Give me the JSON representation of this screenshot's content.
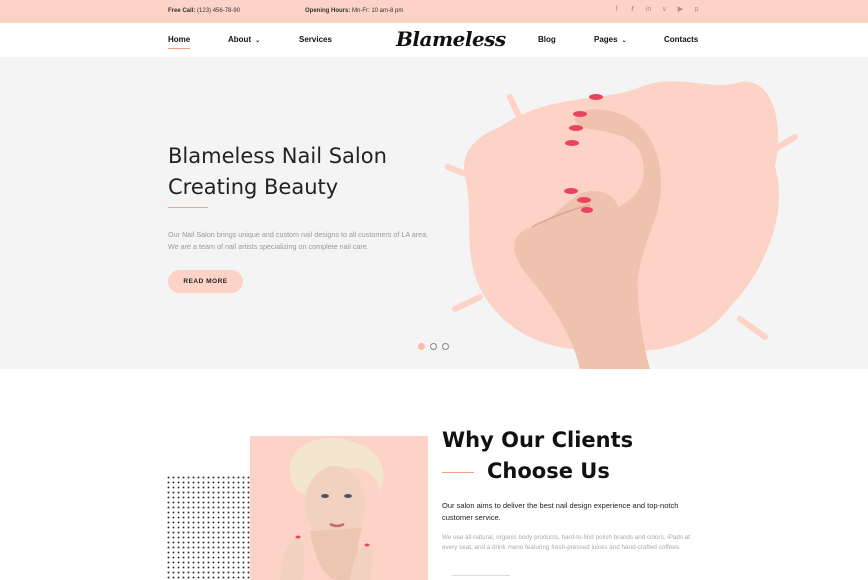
{
  "topbar": {
    "phone_label": "Free Call:",
    "phone_value": "(123) 456-78-90",
    "hours_label": "Opening Hours:",
    "hours_value": "Mn-Fr: 10 am-8 pm",
    "social": [
      "f",
      "t",
      "in",
      "v",
      "yt",
      "p"
    ]
  },
  "nav": {
    "home": "Home",
    "about": "About",
    "services": "Services",
    "logo": "Blameless",
    "blog": "Blog",
    "pages": "Pages",
    "contacts": "Contacts"
  },
  "hero": {
    "title_line1": "Blameless Nail Salon",
    "title_line2": "Creating Beauty",
    "description": "Our Nail Salon brings unique and custom nail designs to all customers of LA area. We are a team of nail artists specializing on complete nail care.",
    "button": "READ MORE",
    "slides": 3,
    "active_slide": 1
  },
  "about": {
    "title_line1": "Why Our Clients",
    "title_line2": "Choose Us",
    "lead": "Our salon aims to deliver the best nail design experience and top-notch customer service.",
    "body": "We use all-natural, organic body products, hard-to-find polish brands and colors, iPads at every seat, and a drink menu featuring fresh-pressed juices and hand-crafted coffees."
  },
  "colors": {
    "accent": "#fcd3c6",
    "accent_line": "#f4a08c",
    "nail": "#e8445f"
  }
}
